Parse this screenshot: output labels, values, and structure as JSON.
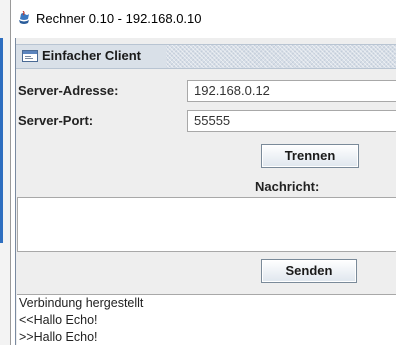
{
  "window": {
    "title": "Rechner 0.10 - 192.168.0.10",
    "app_icon": "java-cup-icon"
  },
  "frame": {
    "title": "Einfacher Client",
    "icon": "window-icon"
  },
  "form": {
    "server_address_label": "Server-Adresse:",
    "server_address_value": "192.168.0.12",
    "server_port_label": "Server-Port:",
    "server_port_value": "55555",
    "disconnect_button": "Trennen",
    "message_label": "Nachricht:",
    "message_value": "",
    "send_button": "Senden"
  },
  "log": {
    "lines": [
      "Verbindung hergestellt",
      "<<Hallo Echo!",
      ">>Hallo Echo!"
    ]
  }
}
